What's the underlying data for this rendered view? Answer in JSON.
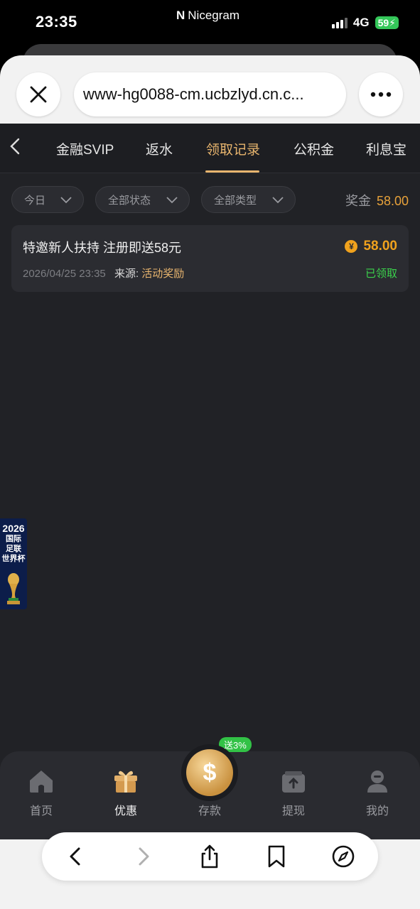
{
  "status_bar": {
    "time": "23:35",
    "app_name": "Nicegram",
    "network": "4G",
    "battery": "59"
  },
  "browser": {
    "url": "www-hg0088-cm.ucbzlyd.cn.c...",
    "close_icon": "close-icon",
    "more_icon": "more-icon"
  },
  "tabs": {
    "items": [
      {
        "label": "金融SVIP",
        "active": false
      },
      {
        "label": "返水",
        "active": false
      },
      {
        "label": "领取记录",
        "active": true
      },
      {
        "label": "公积金",
        "active": false
      },
      {
        "label": "利息宝",
        "active": false
      }
    ]
  },
  "filters": {
    "date": "今日",
    "status": "全部状态",
    "type": "全部类型",
    "bonus_label": "奖金",
    "bonus_value": "58.00"
  },
  "records": [
    {
      "title": "特邀新人扶持 注册即送58元",
      "amount": "58.00",
      "currency_symbol": "¥",
      "date": "2026/04/25 23:35",
      "source_label": "来源:",
      "source": "活动奖励",
      "status": "已领取"
    }
  ],
  "promo": {
    "year": "2026",
    "line1": "国际",
    "line2": "足联",
    "line3": "世界杯"
  },
  "bottom_nav": {
    "items": [
      {
        "label": "首页",
        "icon": "home-icon"
      },
      {
        "label": "优惠",
        "icon": "gift-icon"
      },
      {
        "label": "存款",
        "icon": "deposit-coin-icon"
      },
      {
        "label": "提现",
        "icon": "withdraw-icon"
      },
      {
        "label": "我的",
        "icon": "profile-icon"
      }
    ],
    "deposit_badge": "送3%",
    "deposit_symbol": "$"
  },
  "colors": {
    "accent": "#e8b56e",
    "amount": "#f0a21d",
    "success": "#3bd24c",
    "background": "#212226"
  }
}
